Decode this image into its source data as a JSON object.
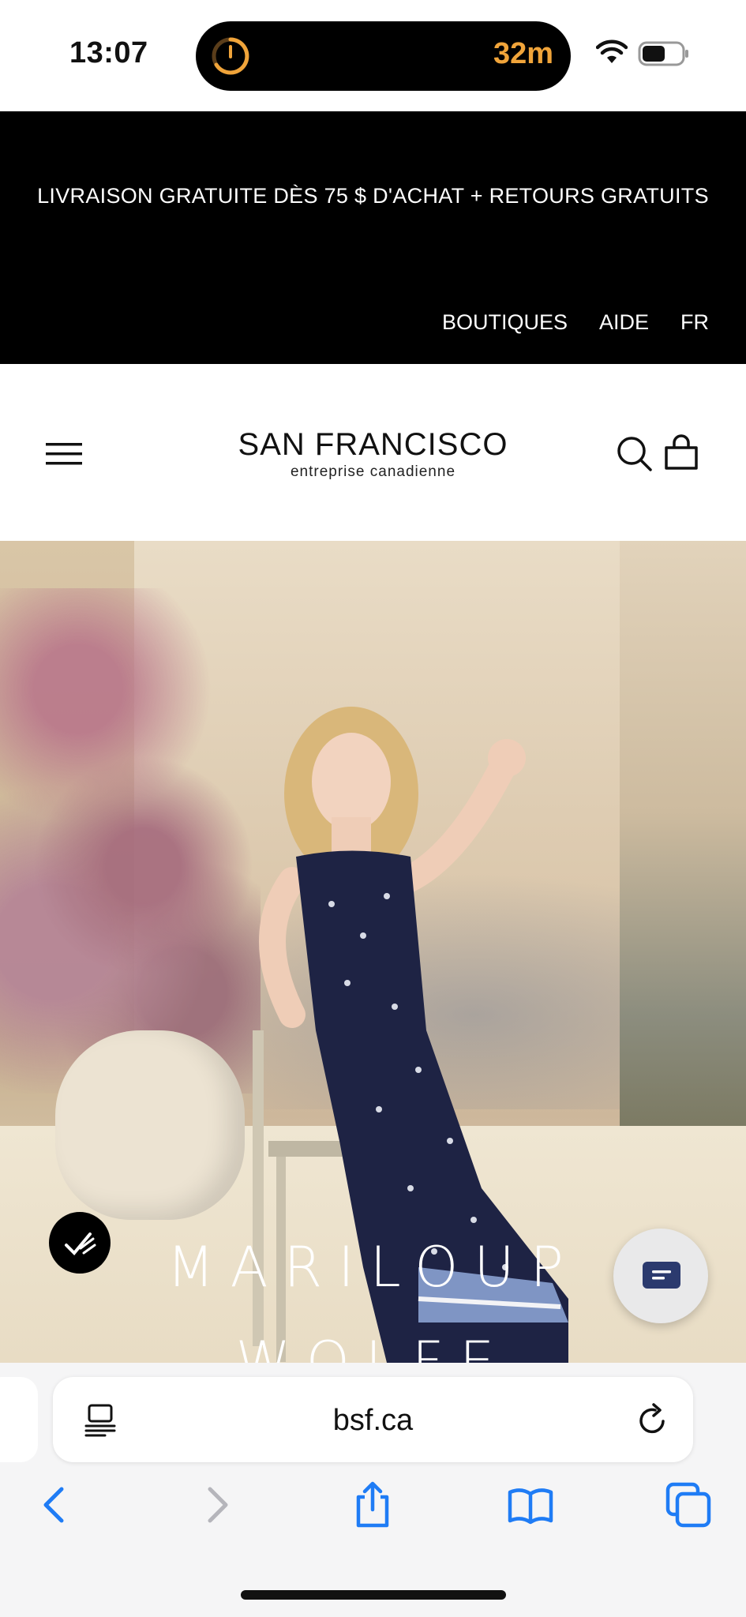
{
  "status_bar": {
    "time": "13:07",
    "timer": "32m",
    "icons": [
      "timer-icon",
      "wifi-icon",
      "battery-icon"
    ]
  },
  "promo": {
    "text": "LIVRAISON GRATUITE DÈS 75 $ D'ACHAT + RETOURS GRATUITS",
    "links": [
      "BOUTIQUES",
      "AIDE",
      "FR"
    ]
  },
  "header": {
    "logo_main": "SAN FRANCISCO",
    "logo_sub": "entreprise canadienne",
    "icons": [
      "menu-icon",
      "search-icon",
      "cart-icon"
    ]
  },
  "hero": {
    "title_line1": "MARILOUP",
    "title_line2": "WOLFE"
  },
  "browser": {
    "url": "bsf.ca",
    "toolbar": [
      "back-icon",
      "forward-icon",
      "share-icon",
      "bookmarks-icon",
      "tabs-icon"
    ]
  },
  "colors": {
    "promo_bg": "#000000",
    "timer_accent": "#f0a43a",
    "toolbar_blue": "#1f7cf5"
  }
}
